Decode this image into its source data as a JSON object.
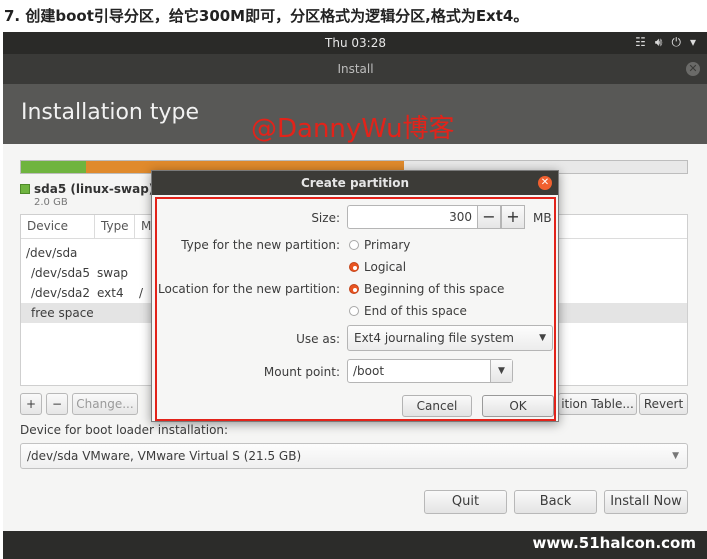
{
  "caption": "7. 创建boot引导分区，给它300M即可，分区格式为逻辑分区,格式为Ext4。",
  "topbar": {
    "clock": "Thu 03:28",
    "tray_icons": [
      "network-icon",
      "volume-icon",
      "power-icon",
      "chevron-down-icon"
    ]
  },
  "window": {
    "title": "Install",
    "page_title": "Installation type",
    "watermark": "@DannyWu博客"
  },
  "legend": {
    "name": "sda5 (linux-swap)",
    "size": "2.0 GB",
    "color": "#6fb43f"
  },
  "partition_bar": {
    "segments": [
      {
        "name": "sda5",
        "color": "#6fb43f"
      },
      {
        "name": "sda2",
        "color": "#e08a2c"
      },
      {
        "name": "free",
        "color": "#e8e8e8"
      }
    ]
  },
  "table": {
    "headers": [
      "Device",
      "Type",
      "M"
    ],
    "rows": [
      {
        "device": "/dev/sda",
        "type": "",
        "mount": ""
      },
      {
        "device": "/dev/sda5",
        "type": "swap",
        "mount": ""
      },
      {
        "device": "/dev/sda2",
        "type": "ext4",
        "mount": "/"
      },
      {
        "device": "free space",
        "type": "",
        "mount": ""
      }
    ]
  },
  "table_buttons": {
    "add": "+",
    "remove": "−",
    "change": "Change...",
    "new_table": "ition Table...",
    "revert": "Revert"
  },
  "bootloader": {
    "label": "Device for boot loader installation:",
    "value": "/dev/sda   VMware, VMware Virtual S (21.5 GB)"
  },
  "footer": {
    "quit": "Quit",
    "back": "Back",
    "install": "Install Now"
  },
  "site_watermark": "www.51halcon.com",
  "dialog": {
    "title": "Create partition",
    "size_label": "Size:",
    "size_value": "300",
    "minus": "−",
    "plus": "+",
    "unit": "MB",
    "type_label": "Type for the new partition:",
    "type_options": [
      "Primary",
      "Logical"
    ],
    "type_selected": "Logical",
    "location_label": "Location for the new partition:",
    "location_options": [
      "Beginning of this space",
      "End of this space"
    ],
    "location_selected": "Beginning of this space",
    "use_as_label": "Use as:",
    "use_as_value": "Ext4 journaling file system",
    "mount_label": "Mount point:",
    "mount_value": "/boot",
    "cancel": "Cancel",
    "ok": "OK"
  }
}
